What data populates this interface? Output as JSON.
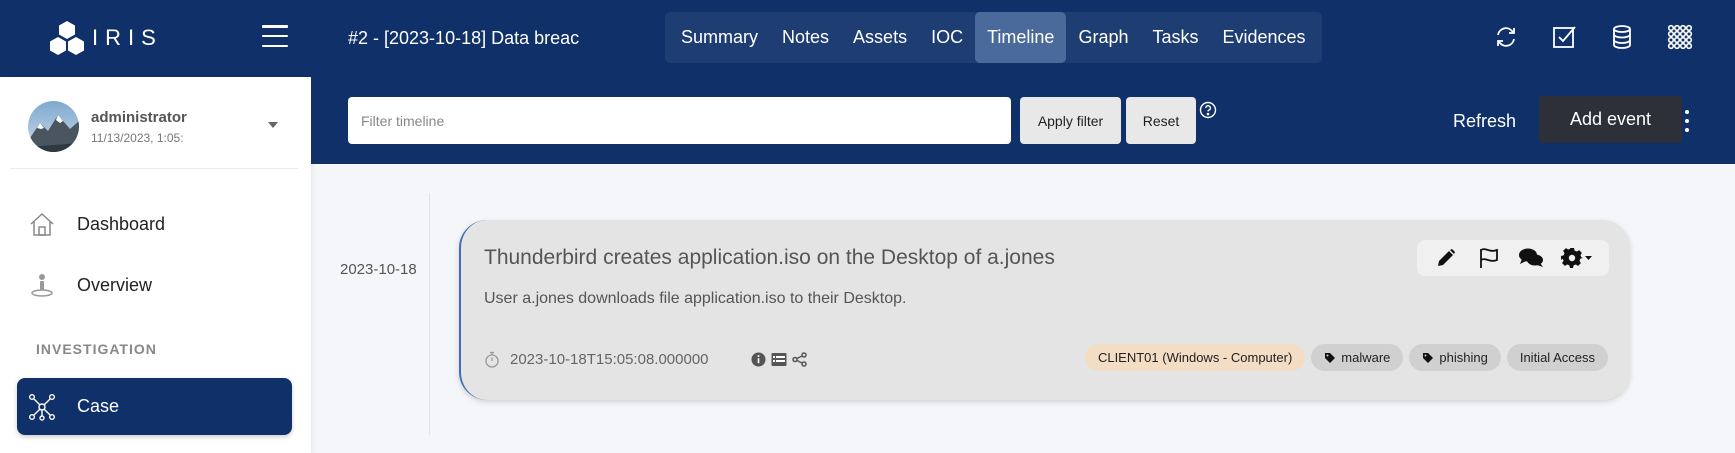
{
  "app": {
    "name": "IRIS"
  },
  "header": {
    "case_title": "#2 - [2023-10-18] Data breac",
    "tabs": [
      {
        "label": "Summary",
        "active": false
      },
      {
        "label": "Notes",
        "active": false
      },
      {
        "label": "Assets",
        "active": false
      },
      {
        "label": "IOC",
        "active": false
      },
      {
        "label": "Timeline",
        "active": true
      },
      {
        "label": "Graph",
        "active": false
      },
      {
        "label": "Tasks",
        "active": false
      },
      {
        "label": "Evidences",
        "active": false
      }
    ],
    "icons": [
      "sync-icon",
      "task-check-icon",
      "database-icon",
      "apps-grid-icon"
    ]
  },
  "sidebar": {
    "user": {
      "name": "administrator",
      "date": "11/13/2023, 1:05:"
    },
    "items": [
      {
        "label": "Dashboard",
        "icon": "home-icon"
      },
      {
        "label": "Overview",
        "icon": "overview-icon"
      }
    ],
    "section_label": "INVESTIGATION",
    "active_item": {
      "label": "Case",
      "icon": "case-network-icon"
    }
  },
  "toolbar": {
    "filter_placeholder": "Filter timeline",
    "apply_label": "Apply filter",
    "reset_label": "Reset",
    "refresh_label": "Refresh",
    "add_event_label": "Add event"
  },
  "timeline": {
    "date": "2023-10-18",
    "event": {
      "title": "Thunderbird creates application.iso on the Desktop of a.jones",
      "description": "User a.jones downloads file application.iso to their Desktop.",
      "timestamp": "2023-10-18T15:05:08.000000",
      "asset_tag": "CLIENT01 (Windows - Computer)",
      "tags": [
        "malware",
        "phishing"
      ],
      "category": "Initial Access"
    }
  },
  "colors": {
    "brand": "#0f3068",
    "active_tab": "#4a6a9c",
    "add_event_bg": "#2d3038",
    "card_bg": "#e4e4e4",
    "asset_tag_bg": "#f3ddc4"
  }
}
